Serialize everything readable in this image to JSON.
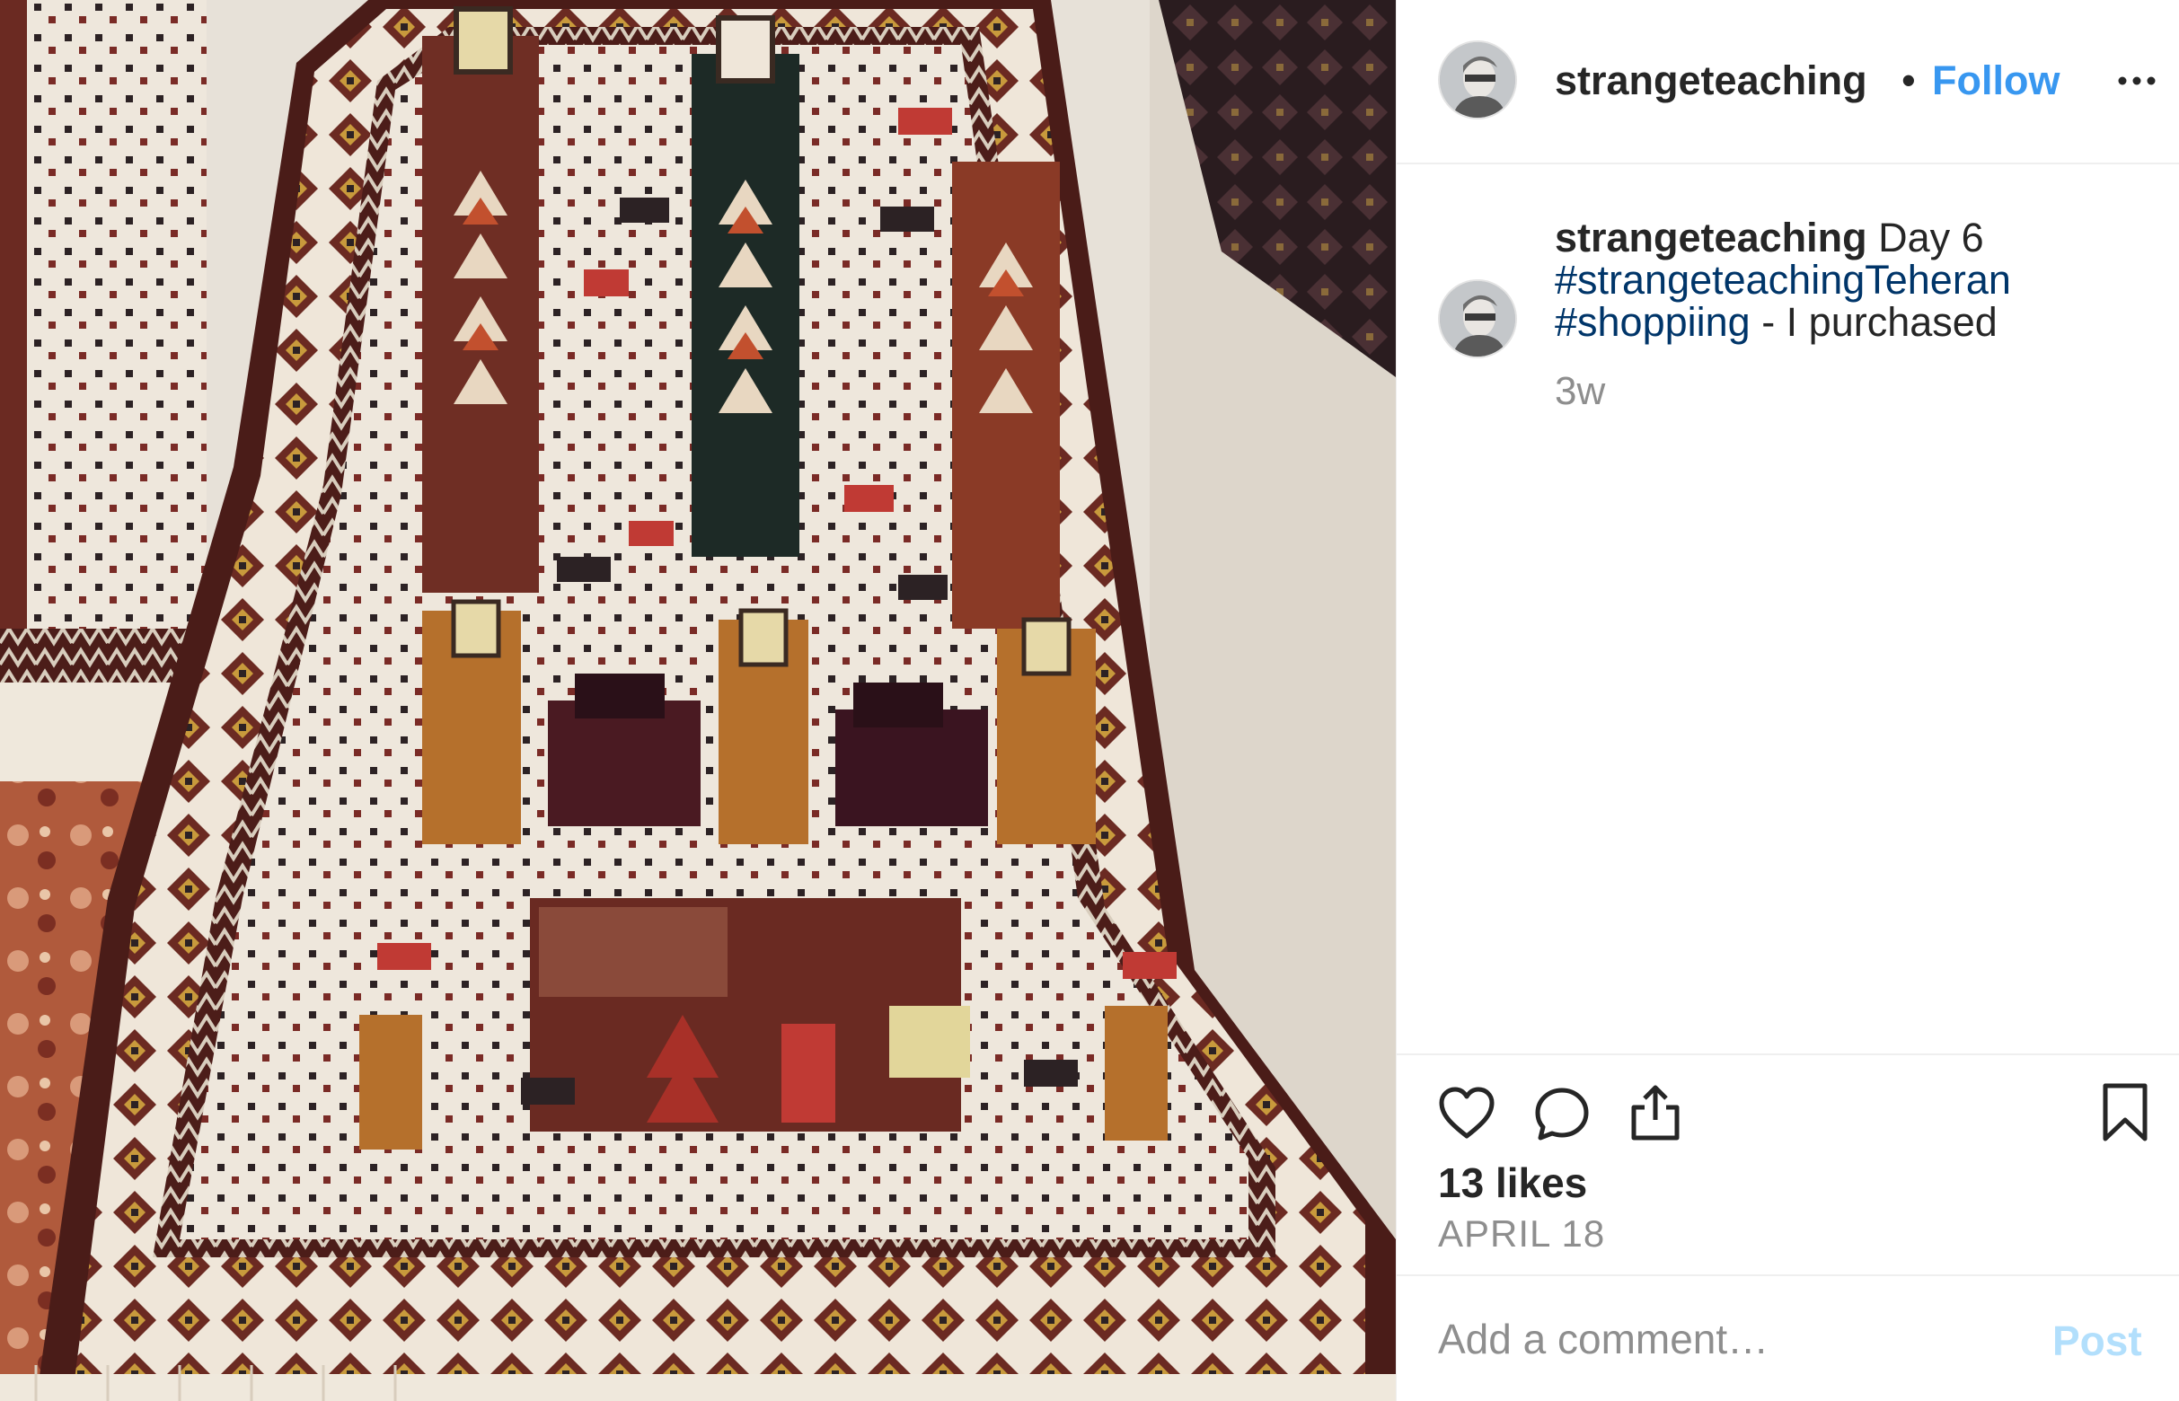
{
  "post": {
    "photo_alt": "",
    "author": {
      "username": "strangeteaching",
      "separator": "•",
      "follow_label": "Follow"
    },
    "header_icons": {
      "avatar": "avatar-icon",
      "more": "more-options-icon"
    },
    "caption": {
      "username": "strangeteaching",
      "text_1": " Day 6 ",
      "hashtag_1": "#strangeteachingTeheran",
      "text_2": " ",
      "hashtag_2": "#shoppiing",
      "text_3": " - I purchased",
      "time": "3w"
    },
    "actions": {
      "icons": [
        "heart-icon",
        "comment-icon",
        "share-icon",
        "bookmark-icon"
      ],
      "likes": "13 likes",
      "date": "APRIL 18"
    },
    "comment_box": {
      "placeholder": "Add a comment…",
      "post_label": "Post"
    },
    "colors": {
      "link_blue": "#3897f0",
      "hashtag_blue": "#003569",
      "muted": "#8e8e8e",
      "post_disabled": "#b2dffc",
      "border": "#efefef"
    }
  }
}
